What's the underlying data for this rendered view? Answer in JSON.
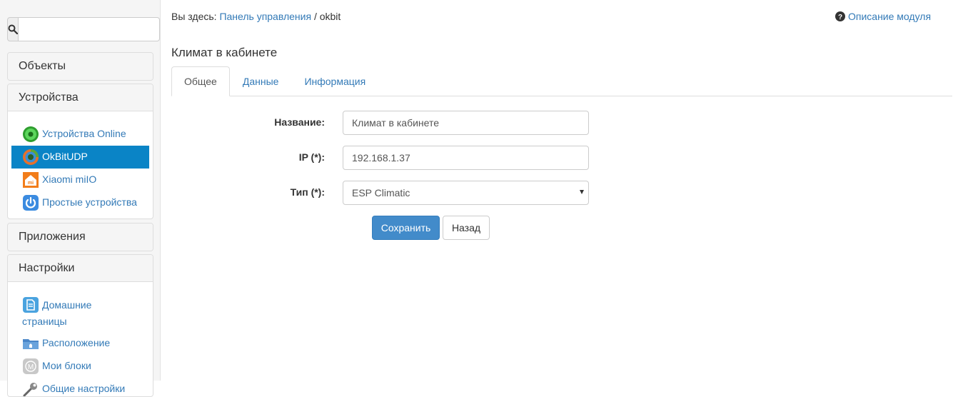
{
  "sidebar": {
    "search": {
      "value": "",
      "placeholder": ""
    },
    "panels": {
      "objects": {
        "title": "Объекты"
      },
      "devices": {
        "title": "Устройства",
        "items": [
          {
            "label": "Устройства Online",
            "icon": "green-circle-icon"
          },
          {
            "label": "OkBitUDP",
            "icon": "okbit-icon"
          },
          {
            "label": "Xiaomi miIO",
            "icon": "xiaomi-home-icon"
          },
          {
            "label": "Простые устройства",
            "icon": "power-icon"
          }
        ]
      },
      "apps": {
        "title": "Приложения"
      },
      "settings": {
        "title": "Настройки",
        "items": [
          {
            "label": "Домашние страницы",
            "icon": "document-icon"
          },
          {
            "label": "Расположение",
            "icon": "folder-icon"
          },
          {
            "label": "Мои блоки",
            "icon": "m-block-icon"
          },
          {
            "label": "Общие настройки",
            "icon": "wrench-icon"
          }
        ]
      }
    }
  },
  "header": {
    "breadcrumb_prefix": "Вы здесь:",
    "breadcrumb_link": "Панель управления",
    "breadcrumb_sep": "/",
    "breadcrumb_current": "okbit",
    "help_link": "Описание модуля"
  },
  "main": {
    "title": "Климат в кабинете",
    "tabs": [
      {
        "label": "Общее",
        "active": true
      },
      {
        "label": "Данные",
        "active": false
      },
      {
        "label": "Информация",
        "active": false
      }
    ],
    "form": {
      "name_label": "Название:",
      "name_value": "Климат в кабинете",
      "ip_label": "IP (*):",
      "ip_value": "192.168.1.37",
      "type_label": "Тип (*):",
      "type_value": "ESP Climatic"
    },
    "buttons": {
      "save": "Сохранить",
      "back": "Назад"
    }
  },
  "colors": {
    "accent": "#337ab7",
    "active_nav": "#0a84c6",
    "primary_button": "#428bca"
  }
}
